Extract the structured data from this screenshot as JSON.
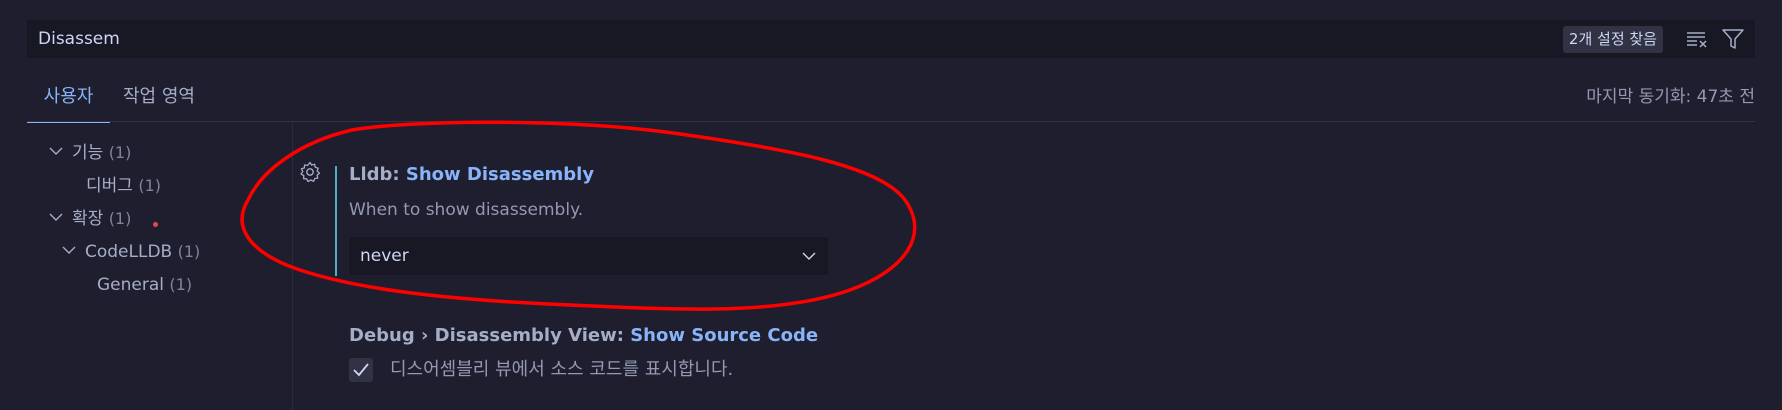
{
  "search": {
    "value": "Disassem",
    "result_count": "2개 설정 찾음",
    "clear_icon": "clear-filter-icon",
    "filter_icon": "filter-icon"
  },
  "tabs": [
    {
      "label": "사용자",
      "active": true
    },
    {
      "label": "작업 영역",
      "active": false
    }
  ],
  "sync_status": "마지막 동기화: 47초 전",
  "tree": [
    {
      "label": "기능",
      "count": "(1)",
      "expanded": true
    },
    {
      "label": "디버그",
      "count": "(1)"
    },
    {
      "label": "확장",
      "count": "(1)",
      "expanded": true,
      "modified": true
    },
    {
      "label": "CodeLLDB",
      "count": "(1)",
      "expanded": true
    },
    {
      "label": "General",
      "count": "(1)"
    }
  ],
  "settings": [
    {
      "category": "Lldb: ",
      "name": "Show Disassembly",
      "description": "When to show disassembly.",
      "value": "never",
      "control": "select"
    },
    {
      "category": "Debug › Disassembly View: ",
      "name": "Show Source Code",
      "description": "디스어셈블리 뷰에서 소스 코드를 표시합니다.",
      "checked": true,
      "control": "checkbox"
    }
  ],
  "colors": {
    "background": "#1e1e2e",
    "accent": "#89b4fa",
    "focus_bar": "#4bb0c6",
    "modified_dot": "#e64553",
    "annotation": "#ff0000"
  }
}
